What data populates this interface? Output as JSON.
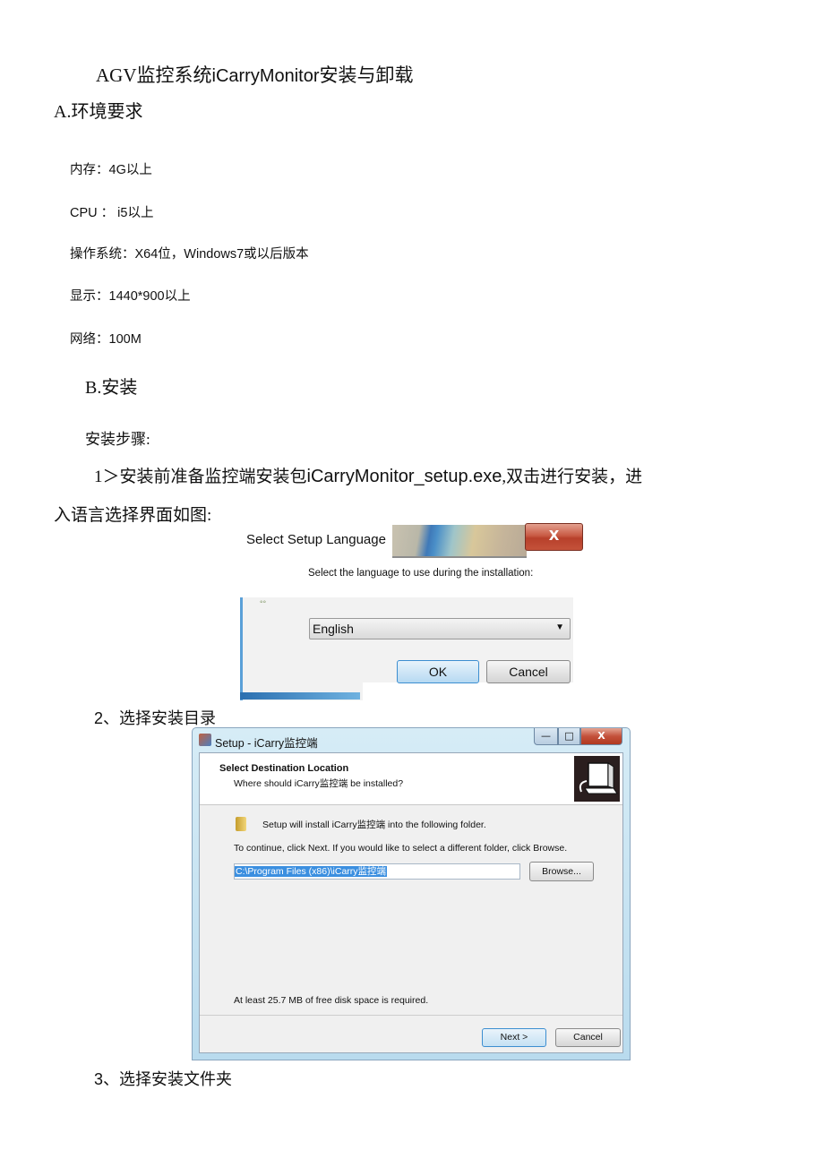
{
  "document": {
    "title_prefix": "AGV监控系统",
    "title_brand": "iCarryMonitor",
    "title_suffix": "安装与卸载",
    "section_a": "A.环境要求",
    "requirements": [
      "内存：4G以上",
      "CPU ：  i5以上",
      "操作系统：X64位，Windows7或以后版本",
      "显示：1440*900以上",
      "网络：100M"
    ],
    "section_b": "B.安装",
    "steps_label": "安装步骤:",
    "step1_prefix": "1＞安装前准备监控端安装包",
    "step1_file": "iCarryMonitor_setup.exe",
    "step1_suffix": ",双击进行安装，进",
    "step1_line2": "入语言选择界面如图:",
    "step2": "2、选择安装目录",
    "step3": "3、选择安装文件夹"
  },
  "language_dialog": {
    "title": "Select Setup Language",
    "close_glyph": "X",
    "prompt": "Select the language to use during the installation:",
    "selected_language": "English",
    "dropdown_arrow": "▼",
    "ok_label": "OK",
    "cancel_label": "Cancel"
  },
  "setup_window": {
    "title": "Setup - iCarry监控端",
    "minimize_glyph": "—",
    "maximize_glyph": "□",
    "close_glyph": "X",
    "header_title": "Select Destination Location",
    "header_subtitle": "Where should iCarry监控端 be installed?",
    "info_text": "Setup will install iCarry监控端 into the following folder.",
    "continue_text": "To continue, click Next. If you would like to select a different folder, click Browse.",
    "install_path": "C:\\Program Files (x86)\\iCarry监控端",
    "browse_label": "Browse...",
    "disk_space_text": "At least 25.7 MB of free disk space is required.",
    "next_label": "Next >",
    "cancel_label": "Cancel"
  }
}
